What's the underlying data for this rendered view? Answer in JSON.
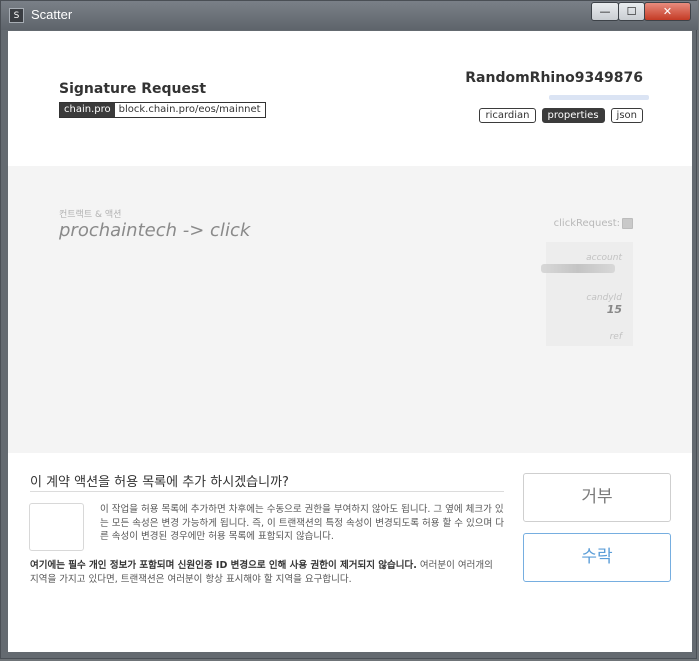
{
  "window": {
    "title": "Scatter",
    "icon_letter": "S",
    "min_label": "—",
    "max_label": "☐",
    "close_label": "✕"
  },
  "header": {
    "title": "Signature Request",
    "chain_name": "chain.pro",
    "chain_url": "block.chain.pro/eos/mainnet",
    "account_name": "RandomRhino9349876",
    "tabs": [
      "ricardian",
      "properties",
      "json"
    ],
    "active_tab": "properties"
  },
  "action": {
    "section_label": "컨트랙트 & 액션",
    "contract_action": "prochaintech -> click",
    "params_title": "clickRequest:",
    "params": [
      {
        "label": "account",
        "value": ""
      },
      {
        "label": "candyId",
        "value": "15"
      },
      {
        "label": "ref",
        "value": ""
      }
    ]
  },
  "whitelist": {
    "question": "이 계약 액션을 허용 목록에 추가 하시겠습니까?",
    "description": "이 작업을 허용 목록에 추가하면 차후에는 수동으로 권한을 부여하지 않아도 됩니다. 그 옆에 체크가 있는 모든 속성은 변경 가능하게 됩니다. 즉, 이 트랜잭션의 특정 속성이 변경되도록 허용 할 수 있으며 다른 속성이 변경된 경우에만 허용 목록에 표함되지 않습니다.",
    "warning_bold": "여기에는 필수 개인 정보가 포함되며 신원인증 ID 변경으로 인해 사용 권한이 제거되지 않습니다.",
    "warning_rest": " 여러분이 여러개의 지역을 가지고 있다면, 트랜잭션은 여러분이 항상 표시해야 할 지역을 요구합니다."
  },
  "buttons": {
    "deny": "거부",
    "accept": "수락"
  }
}
